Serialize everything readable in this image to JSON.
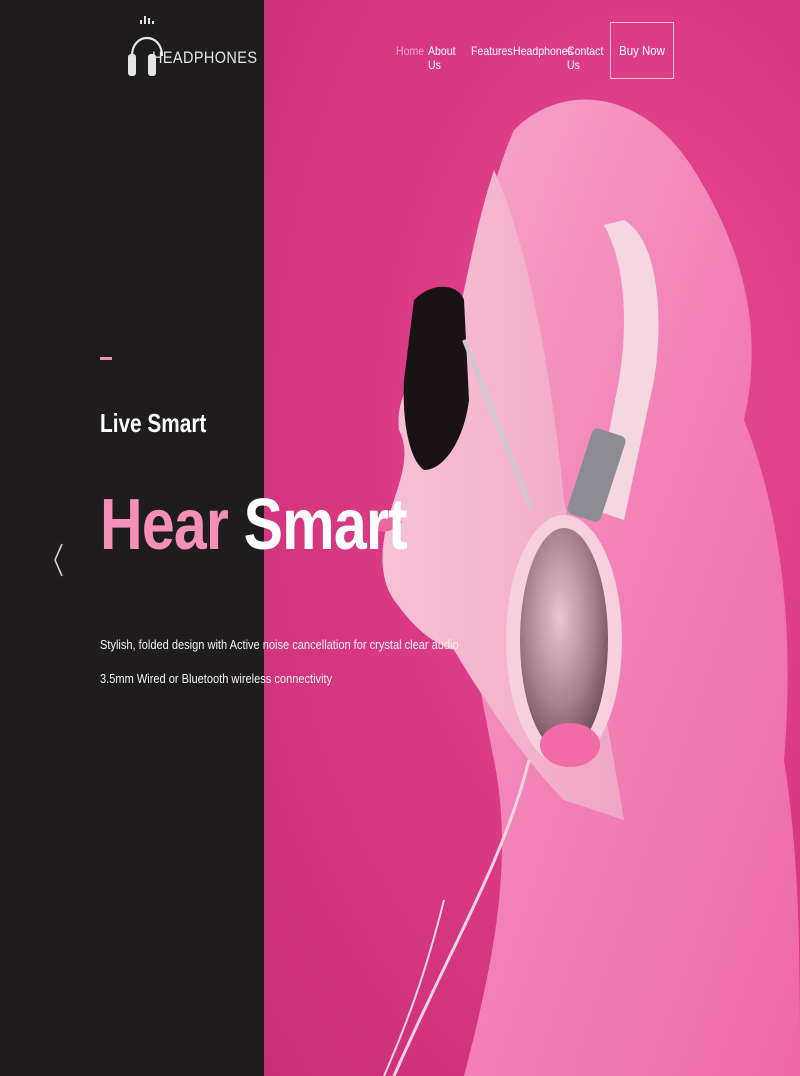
{
  "brand": {
    "name": "HEADPHONES"
  },
  "nav": {
    "items": [
      {
        "label": "Home",
        "active": true
      },
      {
        "label": "About Us"
      },
      {
        "label": "Features"
      },
      {
        "label": "Headphones"
      },
      {
        "label": "Contact Us"
      }
    ],
    "cta": "Buy Now"
  },
  "hero": {
    "subtitle": "Live Smart",
    "headline_word1": "Hear",
    "headline_word2": "Smart",
    "description": "Stylish, folded design with Active noise cancellation for crystal clear audio 3.5mm Wired or Bluetooth wireless connectivity"
  },
  "colors": {
    "accent_pink": "#f48fb8",
    "background_dark": "#1f1c1d",
    "background_magenta": "#dc3b86"
  },
  "icons": {
    "slider_prev": "chevron-left-icon",
    "logo": "headphones-icon"
  }
}
